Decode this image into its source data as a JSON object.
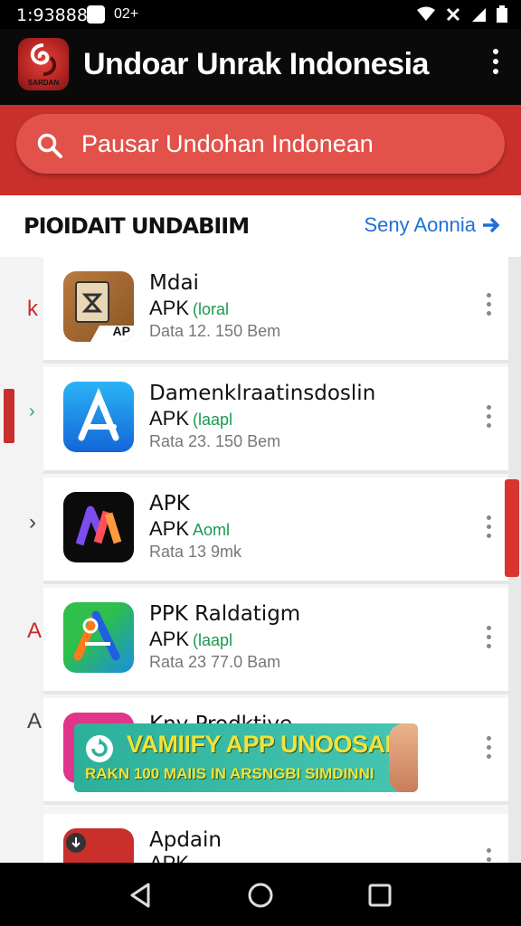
{
  "status": {
    "time": "1:93888",
    "extra": "02+"
  },
  "app": {
    "title": "Undoar Unrak Indonesia",
    "logo_text": "SARDAN"
  },
  "search": {
    "placeholder": "Pausar Undohan Indonean"
  },
  "section": {
    "title": "PIOIDAIT UNDABIIM",
    "see_all": "Seny Aonnia"
  },
  "left_labels": [
    "k",
    "A",
    "A"
  ],
  "apps": [
    {
      "name": "Mdai",
      "sub": "APK",
      "tag": "(loral",
      "meta": "Data 12. 150 Bem",
      "icon_badge": "AP"
    },
    {
      "name": "Damenklraatinsdoslin",
      "sub": "APK",
      "tag": "(laapl",
      "meta": "Rata 23. 150 Bem"
    },
    {
      "name": "APK",
      "sub": "APK",
      "tag": "Aoml",
      "meta": "Rata 13 9mk"
    },
    {
      "name": "PPK Raldatigm",
      "sub": "APK",
      "tag": "(laapl",
      "meta": "Rata 23 77.0 Bam"
    },
    {
      "name": "Kny Prodktive",
      "sub": "",
      "tag": "",
      "meta": ""
    },
    {
      "name": "Apdain",
      "sub": "APK",
      "tag": "",
      "meta": ""
    }
  ],
  "banner": {
    "headline": "VAMIIFY APP UNOOSAN",
    "subline": "RAKN 100 MAIIS IN ARSNGBI SIMDINNI"
  },
  "colors": {
    "brand_red": "#c9302c",
    "link_blue": "#1f6fd6",
    "tag_green": "#1a9950"
  },
  "icons": [
    "search-icon",
    "overflow-menu-icon",
    "arrow-right-icon",
    "back-icon",
    "home-icon",
    "recents-icon"
  ]
}
